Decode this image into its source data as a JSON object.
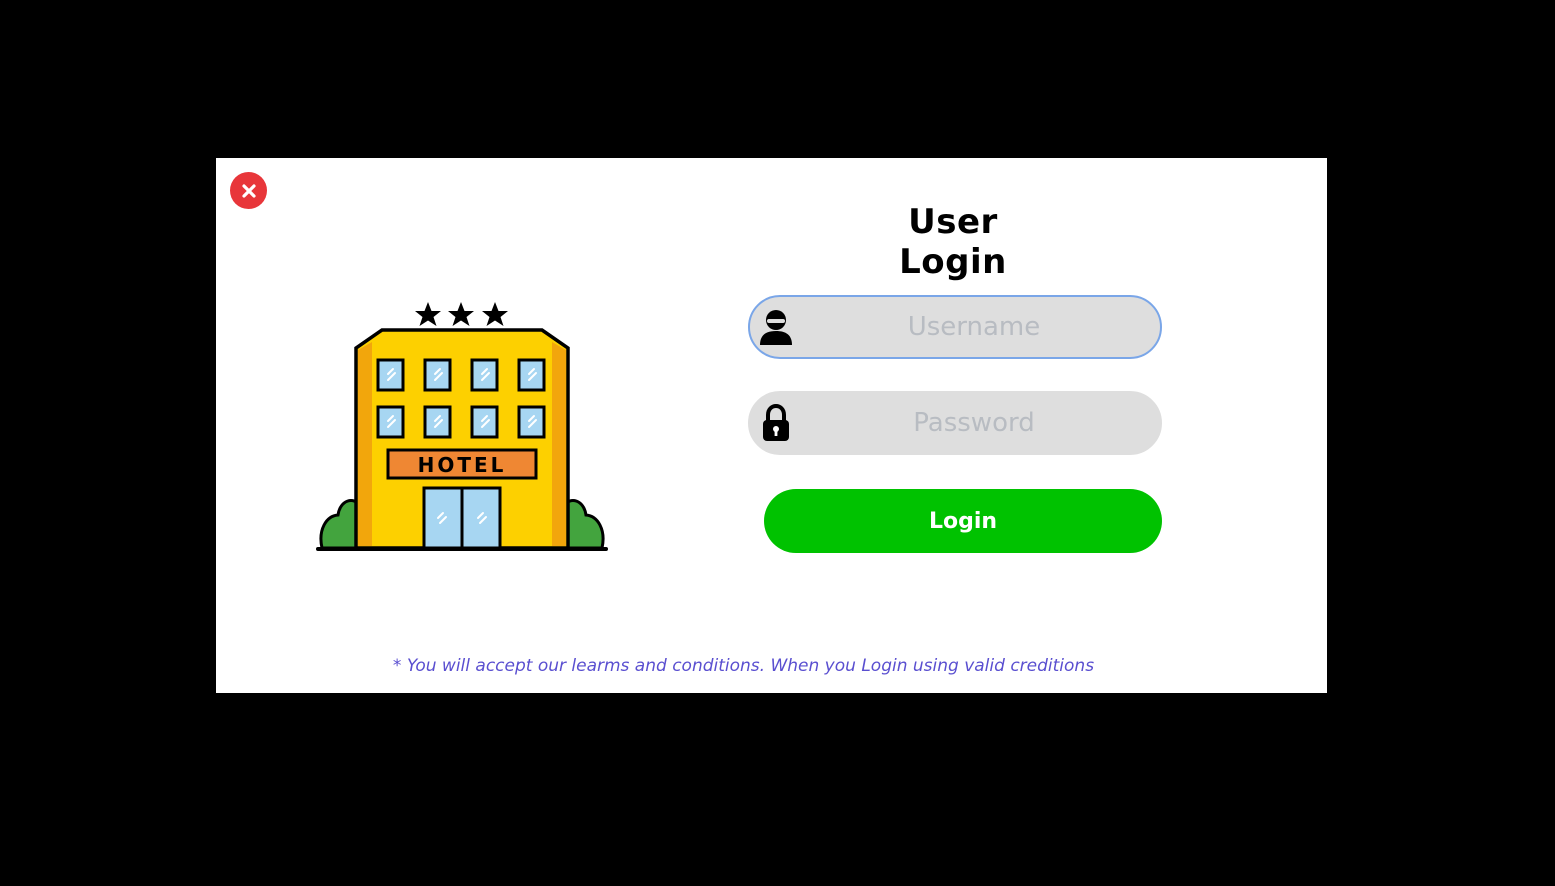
{
  "dialog": {
    "title": "User Login",
    "close_icon": "close-icon",
    "illustration": {
      "icon": "hotel-building-icon",
      "sign_text": "HOTEL",
      "stars": 3
    },
    "username": {
      "placeholder": "Username",
      "value": "",
      "icon": "user-icon"
    },
    "password": {
      "placeholder": "Password",
      "value": "",
      "icon": "lock-icon"
    },
    "login_label": "Login",
    "terms": "* You will accept our learms and conditions. When you Login using valid creditions"
  },
  "colors": {
    "background": "#000000",
    "dialog": "#ffffff",
    "close": "#e8363a",
    "login": "#00c200",
    "field": "#dedede",
    "focus_border": "#7aa6e8",
    "terms_text": "#5a4fd0"
  }
}
